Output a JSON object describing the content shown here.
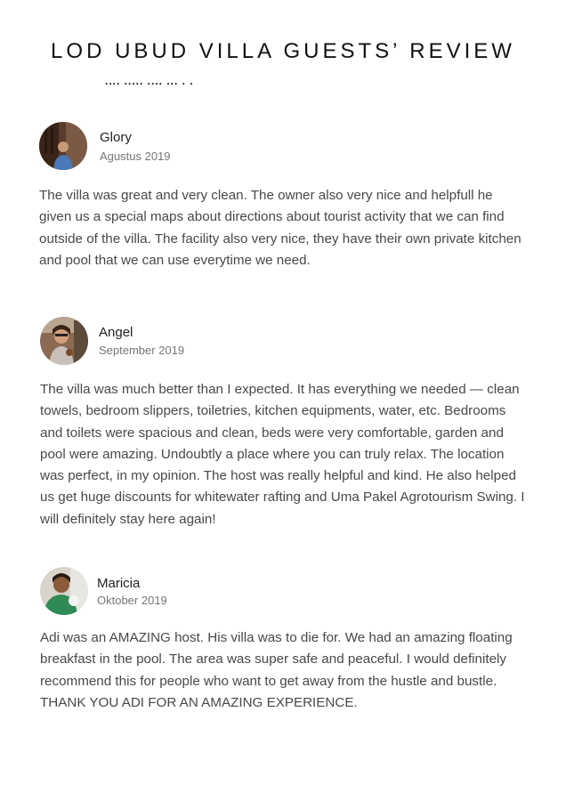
{
  "document": {
    "title": "LOD UBUD VILLA GUESTS’ REVIEW",
    "decoration": ".... ..... .... ... .  ."
  },
  "reviews": [
    {
      "name": "Glory",
      "date": "Agustus 2019",
      "text": "The villa was great and very clean. The owner also very nice and helpfull he given us a special maps about directions about tourist activity that we can find outside of the villa. The facility also very nice, they have their own private kitchen and pool that we can use everytime we need."
    },
    {
      "name": "Angel",
      "date": "September 2019",
      "text": "The villa was much better than I expected. It has everything we needed — clean towels, bedroom slippers, toiletries, kitchen equipments, water, etc. Bedrooms and toilets were spacious and clean, beds were very comfortable, garden and pool were amazing. Undoubtly a place where you can truly relax. The location was perfect, in my opinion. The host was really helpful and kind. He also helped us get huge discounts for whitewater rafting and Uma Pakel Agrotourism Swing. I will definitely stay here again!"
    },
    {
      "name": "Maricia",
      "date": "Oktober 2019",
      "text": "Adi was an AMAZING host. His villa was to die for. We had an amazing floating breakfast in the pool. The area was super safe and peaceful. I would definitely recommend this for people who want to get away from the hustle and bustle. THANK YOU ADI FOR AN AMAZING EXPERIENCE."
    }
  ]
}
